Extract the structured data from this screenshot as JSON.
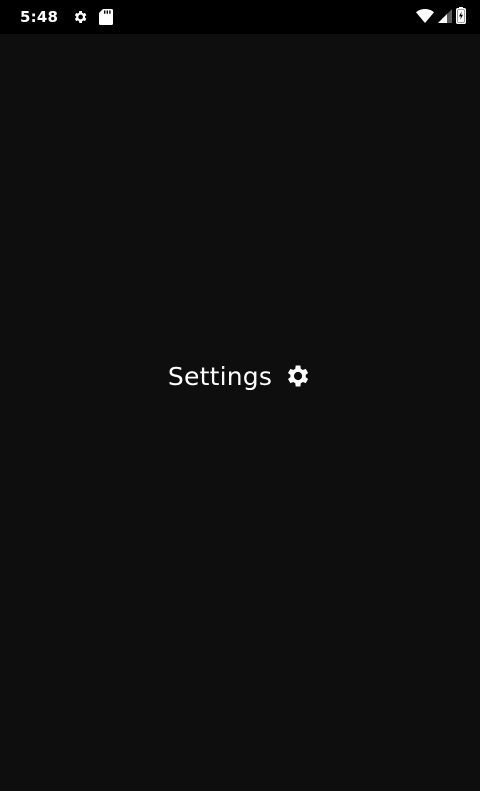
{
  "status_bar": {
    "time": "5:48",
    "left_icons": [
      "gear-icon",
      "sd-card-icon"
    ],
    "right_icons": [
      "wifi-icon",
      "cell-signal-icon",
      "battery-charging-icon"
    ]
  },
  "main": {
    "label": "Settings",
    "icon": "gear-icon"
  },
  "colors": {
    "background": "#0e0e0f",
    "status_bar": "#000000",
    "foreground": "#ffffff"
  }
}
